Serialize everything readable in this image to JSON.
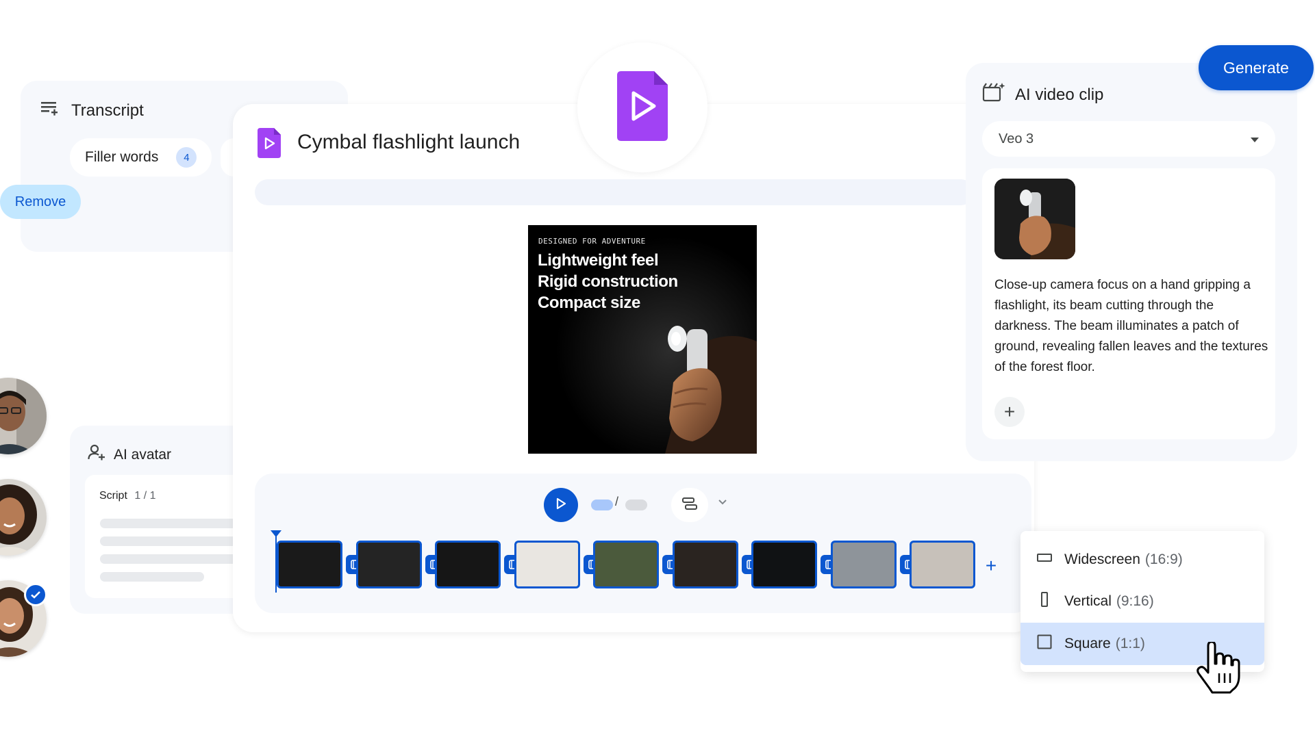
{
  "transcript": {
    "title": "Transcript",
    "filter_chip": {
      "label": "Filler words",
      "count": "4"
    },
    "remove_label": "Remove"
  },
  "avatar_panel": {
    "title": "AI avatar",
    "script_label": "Script",
    "script_page": "1 / 1"
  },
  "editor": {
    "doc_title": "Cymbal flashlight launch",
    "app_icon": "vids-play-icon"
  },
  "preview": {
    "kicker": "DESIGNED FOR ADVENTURE",
    "lines": [
      "Lightweight feel",
      "Rigid construction",
      "Compact size"
    ]
  },
  "timeline": {
    "clip_count": 9
  },
  "video_clip_panel": {
    "title": "AI video clip",
    "generate_label": "Generate",
    "model": "Veo 3",
    "prompt": "Close-up camera focus on a hand gripping a flashlight, its beam cutting through the darkness. The beam illuminates a patch of ground, revealing fallen leaves and the textures of the forest floor."
  },
  "aspect_menu": {
    "items": [
      {
        "label": "Widescreen",
        "ratio": "(16:9)"
      },
      {
        "label": "Vertical",
        "ratio": "(9:16)"
      },
      {
        "label": "Square",
        "ratio": "(1:1)"
      }
    ],
    "selected": "Square"
  },
  "colors": {
    "primary": "#0b57d0",
    "panel_bg": "#f6f8fc",
    "accent_purple": "#a142f4",
    "selected_bg": "#d3e3fd"
  }
}
